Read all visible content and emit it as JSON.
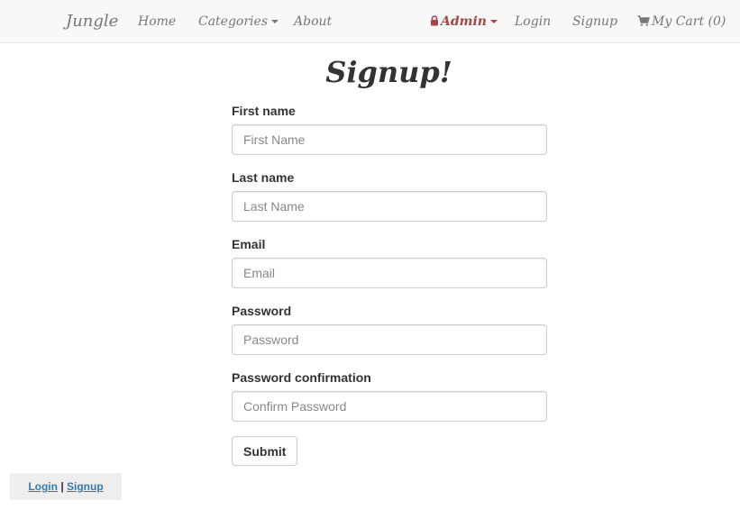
{
  "navbar": {
    "brand": "Jungle",
    "home": "Home",
    "categories": "Categories",
    "about": "About",
    "admin": "Admin",
    "login": "Login",
    "signup": "Signup",
    "cart": "My Cart (0)",
    "admin_color": "#a94442"
  },
  "page": {
    "title": "Signup!"
  },
  "form": {
    "first_name": {
      "label": "First name",
      "placeholder": "First Name",
      "value": ""
    },
    "last_name": {
      "label": "Last name",
      "placeholder": "Last Name",
      "value": ""
    },
    "email": {
      "label": "Email",
      "placeholder": "Email",
      "value": ""
    },
    "password": {
      "label": "Password",
      "placeholder": "Password",
      "value": ""
    },
    "password_confirmation": {
      "label": "Password confirmation",
      "placeholder": "Confirm Password",
      "value": ""
    },
    "submit_label": "Submit"
  },
  "footer": {
    "login": "Login",
    "separator": "|",
    "signup": "Signup",
    "link_color": "#337ab7"
  },
  "icons": {
    "admin": "lock-icon",
    "cart": "shopping-cart-icon"
  }
}
